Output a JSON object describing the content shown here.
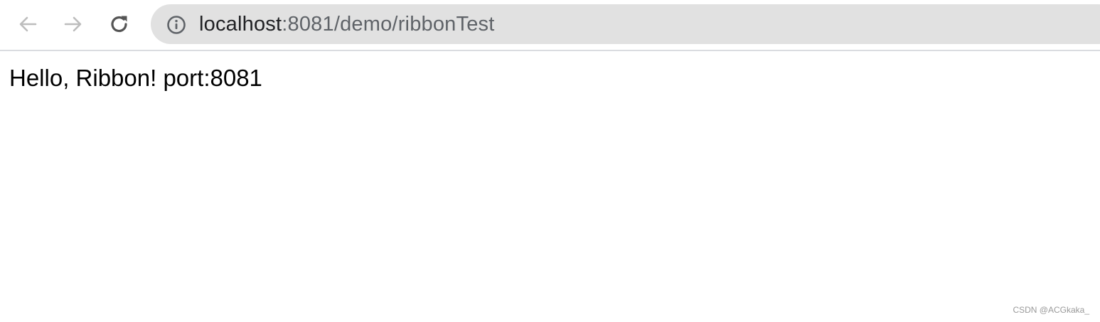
{
  "browser": {
    "address_bar": {
      "url_host": "localhost",
      "url_rest": ":8081/demo/ribbonTest"
    },
    "icons": {
      "back": "back-arrow-icon",
      "forward": "forward-arrow-icon",
      "reload": "reload-icon",
      "site_info": "info-circle-icon"
    },
    "colors": {
      "toolbar_bg": "#ffffff",
      "omnibox_bg": "#e1e1e1",
      "url_host": "#202124",
      "url_path": "#5f6368",
      "disabled_icon": "#bdbdbd",
      "active_icon": "#5f6368"
    }
  },
  "page": {
    "body_text": "Hello, Ribbon! port:8081"
  },
  "watermark": {
    "text": "CSDN @ACGkaka_"
  }
}
